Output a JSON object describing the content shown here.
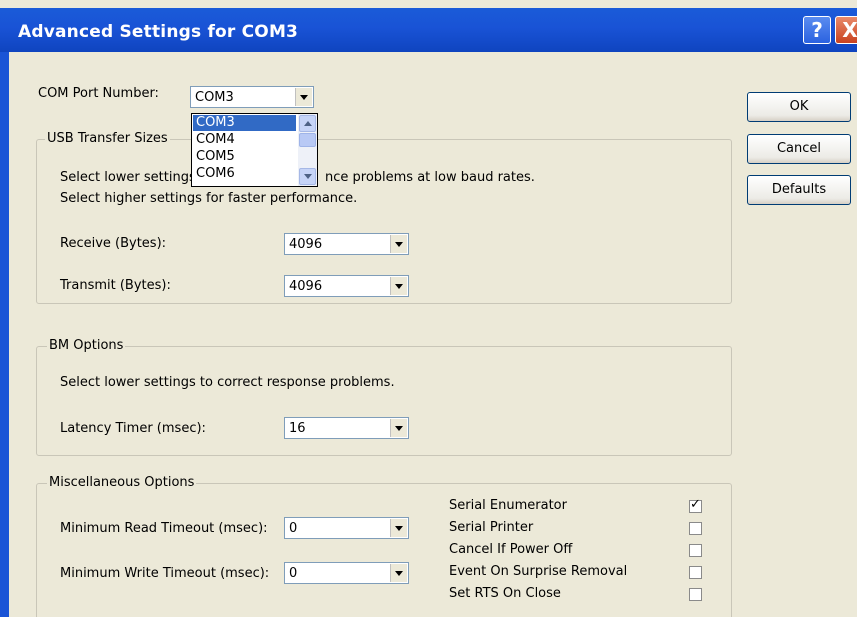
{
  "window": {
    "title": "Advanced Settings for COM3",
    "help_glyph": "?",
    "close_glyph": "X"
  },
  "com_port": {
    "label": "COM Port Number:",
    "value": "COM3",
    "options": [
      "COM3",
      "COM4",
      "COM5",
      "COM6"
    ]
  },
  "usb_transfer": {
    "title": "USB Transfer Sizes",
    "desc_line1_left": "Select lower settings",
    "desc_line1_right": "nce problems at low baud rates.",
    "desc_line2": "Select higher settings for faster performance.",
    "receive_label": "Receive (Bytes):",
    "receive_value": "4096",
    "transmit_label": "Transmit (Bytes):",
    "transmit_value": "4096"
  },
  "bm_options": {
    "title": "BM Options",
    "desc": "Select lower settings to correct response problems.",
    "latency_label": "Latency Timer (msec):",
    "latency_value": "16"
  },
  "misc": {
    "title": "Miscellaneous Options",
    "min_read_label": "Minimum Read Timeout (msec):",
    "min_read_value": "0",
    "min_write_label": "Minimum Write Timeout (msec):",
    "min_write_value": "0",
    "checkboxes": [
      {
        "label": "Serial Enumerator",
        "checked": true
      },
      {
        "label": "Serial Printer",
        "checked": false
      },
      {
        "label": "Cancel If Power Off",
        "checked": false
      },
      {
        "label": "Event On Surprise Removal",
        "checked": false
      },
      {
        "label": "Set RTS On Close",
        "checked": false
      }
    ],
    "check_glyph": "✓"
  },
  "buttons": {
    "ok": "OK",
    "cancel": "Cancel",
    "defaults": "Defaults"
  }
}
